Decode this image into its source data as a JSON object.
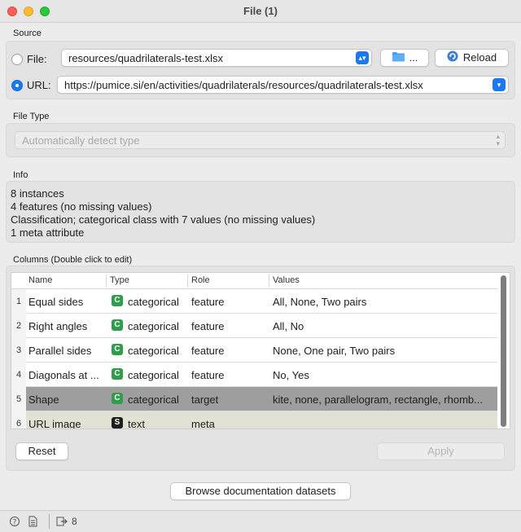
{
  "window": {
    "title": "File (1)"
  },
  "source": {
    "label": "Source",
    "file_label": "File:",
    "file_value": "resources/quadrilaterals-test.xlsx",
    "browse_label": "...",
    "reload_label": "Reload",
    "url_label": "URL:",
    "url_value": "https://pumice.si/en/activities/quadrilaterals/resources/quadrilaterals-test.xlsx",
    "selected": "url"
  },
  "file_type": {
    "label": "File Type",
    "value": "Automatically detect type"
  },
  "info": {
    "label": "Info",
    "lines": [
      "8 instances",
      "4 features (no missing values)",
      "Classification; categorical class with 7 values (no missing values)",
      "1 meta attribute"
    ]
  },
  "columns": {
    "label": "Columns (Double click to edit)",
    "headers": [
      "Name",
      "Type",
      "Role",
      "Values"
    ],
    "rows": [
      {
        "num": "1",
        "name": "Equal sides",
        "type_icon": "C",
        "type": "categorical",
        "role": "feature",
        "values": "All, None, Two pairs"
      },
      {
        "num": "2",
        "name": "Right angles",
        "type_icon": "C",
        "type": "categorical",
        "role": "feature",
        "values": "All, No"
      },
      {
        "num": "3",
        "name": "Parallel sides",
        "type_icon": "C",
        "type": "categorical",
        "role": "feature",
        "values": "None, One pair, Two pairs"
      },
      {
        "num": "4",
        "name": "Diagonals at ...",
        "type_icon": "C",
        "type": "categorical",
        "role": "feature",
        "values": "No, Yes"
      },
      {
        "num": "5",
        "name": "Shape",
        "type_icon": "C",
        "type": "categorical",
        "role": "target",
        "values": "kite, none, parallelogram, rectangle, rhomb..."
      },
      {
        "num": "6",
        "name": "URL image",
        "type_icon": "S",
        "type": "text",
        "role": "meta",
        "values": ""
      }
    ],
    "reset_label": "Reset",
    "apply_label": "Apply"
  },
  "browse_docs_label": "Browse documentation datasets",
  "status": {
    "output_count": "8"
  },
  "colors": {
    "accent": "#1a78f2",
    "categorical_icon": "#2f9d4b",
    "target_row": "#9e9e9e",
    "meta_row": "#e1e2d3"
  }
}
